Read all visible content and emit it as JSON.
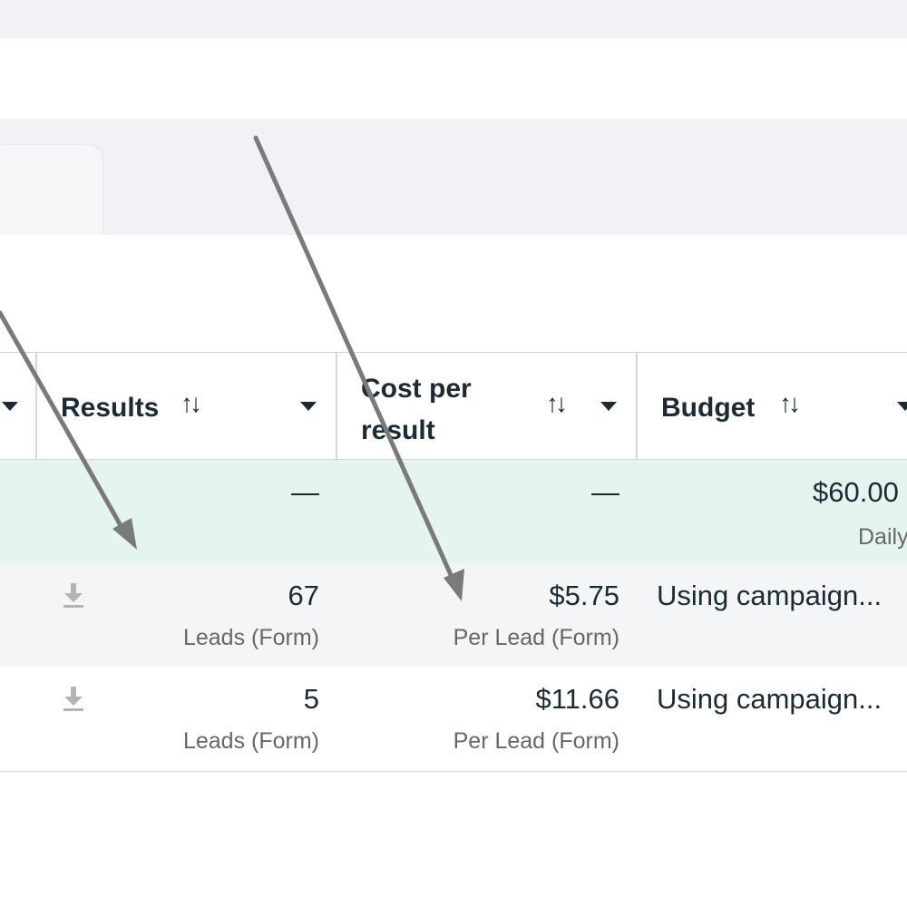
{
  "columns": {
    "results": {
      "label": "Results",
      "sort": "↑↓"
    },
    "cost_per_result": {
      "label_line1": "Cost per",
      "label_line2": "result",
      "sort": "↑↓"
    },
    "budget": {
      "label": "Budget",
      "sort": "↑↓"
    }
  },
  "summary_row": {
    "results": "—",
    "cost": "—",
    "budget": "$60.00",
    "budget_sub": "Daily"
  },
  "rows": [
    {
      "results": "67",
      "results_sub": "Leads (Form)",
      "cost": "$5.75",
      "cost_sub": "Per Lead (Form)",
      "budget": "Using campaign..."
    },
    {
      "results": "5",
      "results_sub": "Leads (Form)",
      "cost": "$11.66",
      "cost_sub": "Per Lead (Form)",
      "budget": "Using campaign..."
    }
  ],
  "colors": {
    "summary_bg": "#e6f4ef",
    "row_alt_bg": "#f4f5f7",
    "arrow": "#7a7a7a"
  }
}
